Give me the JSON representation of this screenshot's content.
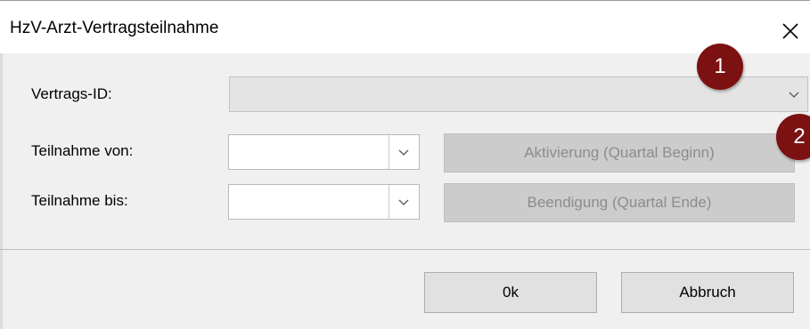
{
  "window": {
    "title": "HzV-Arzt-Vertragsteilnahme"
  },
  "fields": {
    "vertrags_id_label": "Vertrags-ID:",
    "vertrags_id_value": "",
    "teilnahme_von_label": "Teilnahme von:",
    "teilnahme_von_value": "",
    "teilnahme_bis_label": "Teilnahme bis:",
    "teilnahme_bis_value": ""
  },
  "actions": {
    "aktivierung_label": "Aktivierung  (Quartal Beginn)",
    "beendigung_label": "Beendigung  (Quartal Ende)",
    "ok_label": "0k",
    "abbruch_label": "Abbruch"
  },
  "markers": {
    "marker_1": "1",
    "marker_2": "2",
    "color": "#7b1111"
  }
}
